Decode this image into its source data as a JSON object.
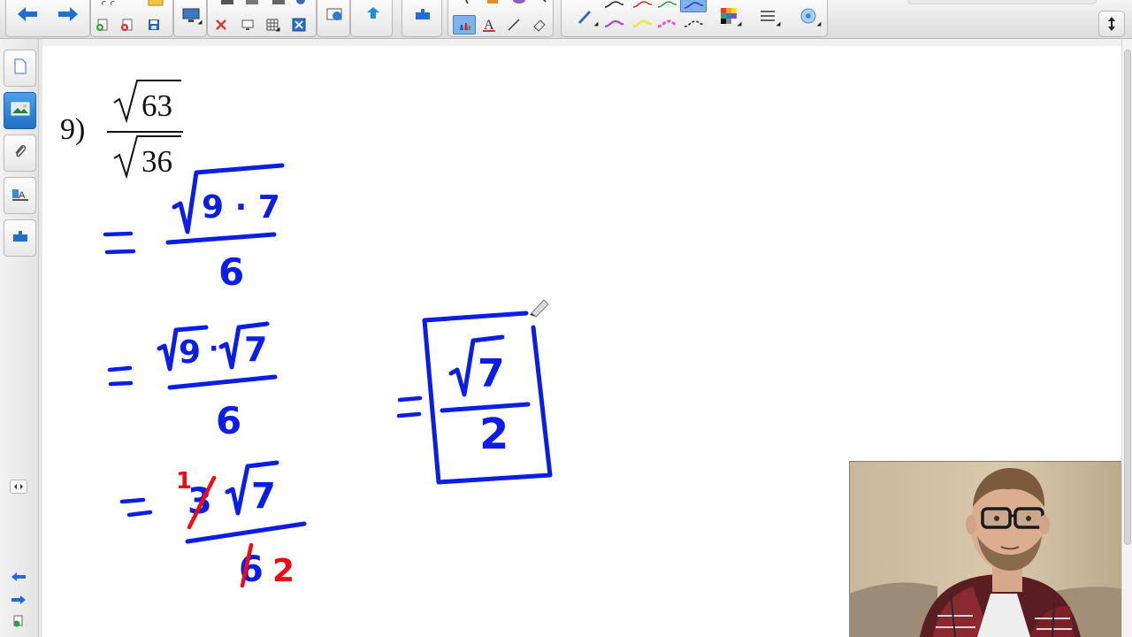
{
  "problem": {
    "number": "9)",
    "numerator": "63",
    "denominator": "36"
  },
  "handwriting": {
    "equals": "=",
    "step1_numerator": "9 · 7",
    "step1_denominator": "6",
    "step2_left": "9",
    "step2_dot": "·",
    "step2_right": "7",
    "step2_denominator": "6",
    "step3_numerator_struck": "3",
    "step3_numerator_new": "1",
    "step3_radicand": "7",
    "step3_denominator_struck": "6",
    "step3_denominator_new": "2",
    "answer_radicand": "7",
    "answer_denominator": "2"
  },
  "colors": {
    "ink_blue": "#0a1ee6",
    "ink_red": "#f00a14",
    "active_pen_bg": "#7fb2ea"
  },
  "icons": {
    "toolbar": [
      "back-arrow-icon",
      "forward-arrow-icon",
      "new-page-icon",
      "delete-page-icon",
      "save-icon",
      "screen-shade-icon",
      "delete-icon",
      "table-icon",
      "clear-page-icon",
      "capture-icon",
      "add-ons-icon",
      "select-icon",
      "pen-icon",
      "text-icon",
      "line-icon",
      "eraser-icon",
      "creative-pen-icon",
      "color-palette-icon",
      "line-style-icon",
      "fill-icon"
    ],
    "sidebar": [
      "page-sorter-icon",
      "gallery-icon",
      "attachments-icon",
      "properties-icon",
      "add-ons-icon"
    ]
  }
}
